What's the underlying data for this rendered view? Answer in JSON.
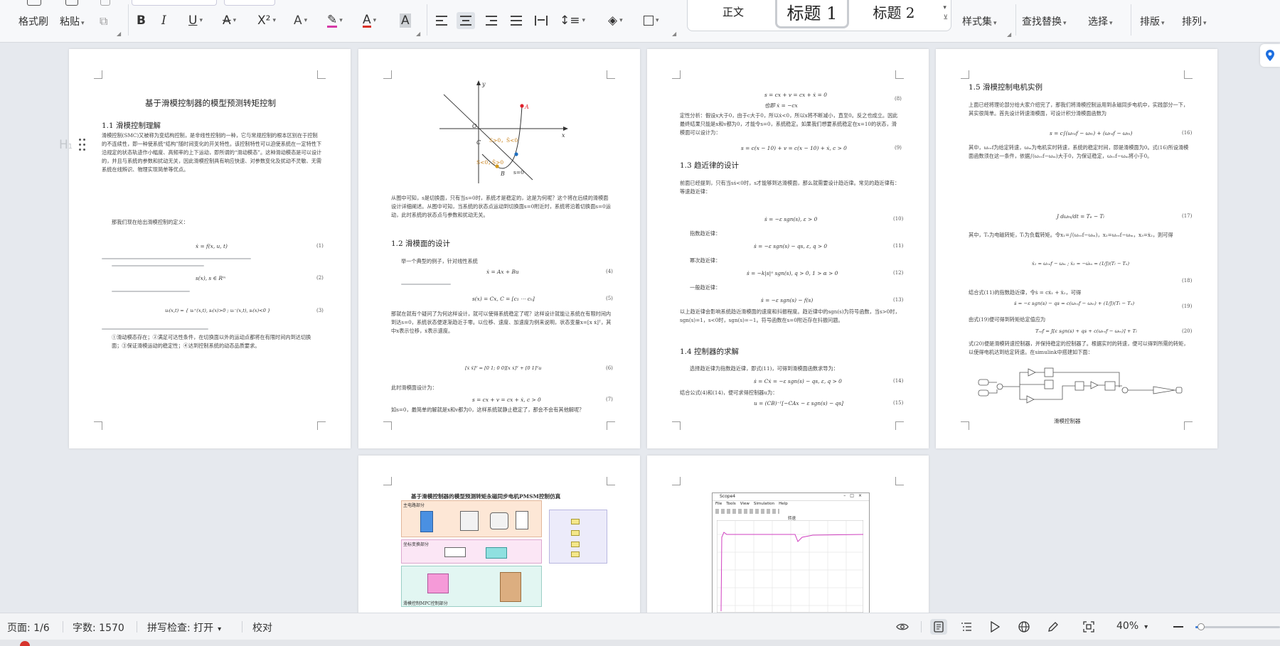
{
  "ribbon": {
    "clipboard": {
      "format_painter": "格式刷",
      "paste": "粘贴"
    },
    "font": {
      "bold": "B",
      "italic": "I",
      "underline": "U",
      "strike": "A",
      "superscript": "X²",
      "font_color": "A"
    },
    "styles": {
      "normal": "正文",
      "heading1": "标题 1",
      "heading2": "标题 2"
    },
    "style_set": "样式集",
    "find_replace": "查找替换",
    "select": "选择",
    "layout": "排版",
    "arrange": "排列"
  },
  "accent_colors": {
    "highlight": "#d63aa6",
    "font_color": "#d93025",
    "h1_selected_border": "#c9ccd1",
    "zoom_slider": "#3b7ddd"
  },
  "pages": {
    "p1": {
      "title": "基于滑模控制器的模型预测转矩控制",
      "section": "1.1 滑模控制理解",
      "para1": "滑模控制(SMC)又被称为变结构控制，是非线性控制的一种，它与常规控制的根本区别在于控制的不连续性，即一种使系统“结构”随时间变化的开关特性。该控制特性可以迫使系统在一定特性下沿规定的状态轨迹作小幅度、高频率的上下运动，即所谓的“滑动模态”。这种滑动模态是可以设计的，并且与系统的参数和扰动无关，因此滑模控制具有响应快速、对参数变化及扰动不灵敏、无需系统在线辨识、物理实现简单等优点。",
      "para2": "那我们现在给出滑模控制的定义：",
      "eq1": "ẋ = f(x, u, t)",
      "eq1n": "(1)",
      "eq2": "s(x), s ∈ Rᵐ",
      "eq2n": "(2)",
      "eq3": "uᵢ(x,t) = { uᵢ⁺(x,t), sᵢ(x)>0 ; uᵢ⁻(x,t), sᵢ(x)<0 }",
      "eq3n": "(3)",
      "para3": "①滑动模态存在；②满足可达性条件，在切换面以外的运动点都将在有限时间内到达切换面；③保证滑模运动的稳定性；④达到控制系统的动态品质要求。"
    },
    "p2": {
      "fig_labels": {
        "y": "y",
        "x": "x",
        "o": "O",
        "a": "A",
        "b": "B",
        "c": "C",
        "s_gt0": "S>0，",
        "sdot_lt0": "Ṡ<0",
        "s_lt0": "S<0，",
        "sdot_gt0": "Ṡ>0",
        "s_eq0": "s=0"
      },
      "para1": "从图中可知，s是切换面，只有当s=0时，系统才是稳定的，这是为何呢？这个将在后续的滑模面设计详细阐述。从图中可知，当系统的状态点运动到切换面s=0附近时，系统将沿着切换面s=0运动，此时系统的状态点与参数和扰动无关。",
      "section": "1.2 滑模面的设计",
      "para2": "举一个典型的例子，针对线性系统",
      "eq4": "ẋ = Ax + Bu",
      "eq4n": "(4)",
      "eq5": "s(x) = Cx,  C = [c₁ ⋯ cₙ]",
      "eq5n": "(5)",
      "para3": "那就在就有个疑问了为何这样设计，就可以使得系统稳定了呢？这样设计就能让系统在有限时间内到达s=0，系统状态便逐渐趋近于零。以位移、速度、加速度为例来说明，状态变量x=[x ẋ]ᵀ，其中x表示位移，ẋ表示速度。",
      "eq6": "[ẋ ẍ]ᵀ = [0 1; 0 0][x ẋ]ᵀ + [0 1]ᵀu",
      "eq6n": "(6)",
      "para4": "此时滑模面设计为：",
      "eq7": "s = cx + v = cx + ẋ,  c > 0",
      "eq7n": "(7)",
      "para5": "如s=0，最简单的解就是x和v都为0，这样系统就静止稳定了，那会不会有其他解呢？"
    },
    "p3": {
      "eq8": "s = cx + v = cx + ẋ = 0",
      "eq8b": "也即 ẋ = −cx",
      "eq8n": "(8)",
      "para1": "定性分析：假设x大于0，由于c大于0，所以ẋ<0，所以x将不断减小，直至0。反之也成立。因此最终结果只能是x和v都为0，才能令s=0，系统稳定。如果我们想要系统稳定在x=10的状态，滑模面可以设计为：",
      "eq9": "s = c(x − 10) + v = c(x − 10) + ẋ,  c > 0",
      "eq9n": "(9)",
      "section1": "1.3 趋近律的设计",
      "para2": "前面已经提到，只有当sṡ<0时，s才能够到达滑模面，那么就需要设计趋近律。常见的趋近律有：等速趋近律：",
      "eq10": "ṡ = −ε sgn(s),  ε > 0",
      "eq10n": "(10)",
      "lbl11": "指数趋近律：",
      "eq11": "ṡ = −ε sgn(s) − qs,  ε, q > 0",
      "eq11n": "(11)",
      "lbl12": "幂次趋近律：",
      "eq12": "ṡ = −k|s|ᵅ sgn(s),  q > 0, 1 > α > 0",
      "eq12n": "(12)",
      "lbl13": "一般趋近律：",
      "eq13": "ṡ = −ε sgn(s) − f(s)",
      "eq13n": "(13)",
      "para3": "以上趋近律会影响系统趋近滑模面的速度和抖振程度。趋近律中的sgn(s)为符号函数，当s>0时，sgn(s)=1，s<0时，sgn(s)=−1。符号函数在s=0附近存在抖振问题。",
      "section2": "1.4 控制器的求解",
      "para4": "选择趋近律为指数趋近律，即式(11)，可得到滑模面函数求导为：",
      "eq14": "ṡ = Cẋ = −ε sgn(s) − qs,  ε, q > 0",
      "eq14n": "(14)",
      "para5": "结合公式(4)和(14)，便可求得控制器u为：",
      "eq15": "u = (CB)⁻¹[−CAx − ε sgn(s) − qs]",
      "eq15n": "(15)"
    },
    "p4": {
      "section": "1.5 滑模控制电机实例",
      "para1": "上面已经将理论部分给大家介绍完了，那我们将滑模控制运用到永磁同步电机中，实践部分一下，其实很简单。首先设计转速滑模面，可设计积分滑模面函数为",
      "eq16": "s = c∫(ωᵣₑf − ωₘ) + (ωᵣₑf − ωₘ)",
      "eq16n": "(16)",
      "para2": "其中，ωᵣₑf为给定转速，ωₘ为电机实时转速，系统的稳定时间，即是滑模面为0。式(16)所设滑模面函数须在这一条件，依据∫(ωᵣₑf−ωₘ)大于0，为保证稳定，ωᵣₑf−ωₘ将小于0。",
      "eq17": "J dωₘ/dt = Tₑ − Tₗ",
      "eq17n": "(17)",
      "para3": "其中，Tₑ为电磁转矩，Tₗ为负载转矩。令x₁=∫(ωᵣₑf−ωₘ)，x₂=ωᵣₑf−ωₘ，x₃=ẋ₂，则可得",
      "eq18": "ẋ₁ = ωᵣₑf − ωₘ ;  ẋ₂ = −ω̇ₘ = (1/J)(Tₗ − Tₑ)",
      "eq18n": "(18)",
      "para4": "结合式(11)的指数趋近律，令ṡ = cẋ₁ + ẋ₂，可得",
      "eq19": "ṡ = −ε sgn(s) − qs = c(ωᵣₑf − ωₘ) + (1/J)(Tₗ − Tₑ)",
      "eq19n": "(19)",
      "para5": "由式(19)便可得到转矩给定值应为",
      "eq20": "Tᵣₑf = J[ε sgn(s) + qs + c(ωᵣₑf − ωₘ)] + Tₗ",
      "eq20n": "(20)",
      "para6": "式(20)便是滑模转速控制器，并保持稳定的控制器了。根据实时的转速，便可以得到所需的转矩，以使得电机达到给定转速。在simulink中搭建如下面：",
      "caption": "滑模控制器"
    },
    "p5": {
      "title": "基于滑模控制器的模型预测转矩永磁同步电机PMSM控制仿真",
      "panel1": "主电路部分",
      "panel2": "坐标变换部分",
      "panel3": "滑模控制MPC控制部分"
    },
    "p6": {
      "window_title": "Scope4",
      "menu": [
        "File",
        "Tools",
        "View",
        "Simulation",
        "Help"
      ],
      "plot_title": "转速"
    }
  },
  "statusbar": {
    "page": "页面: 1/6",
    "words": "字数: 1570",
    "spell": "拼写检查: 打开",
    "proof": "校对",
    "zoom": "40%"
  },
  "zoom_percent": 40
}
